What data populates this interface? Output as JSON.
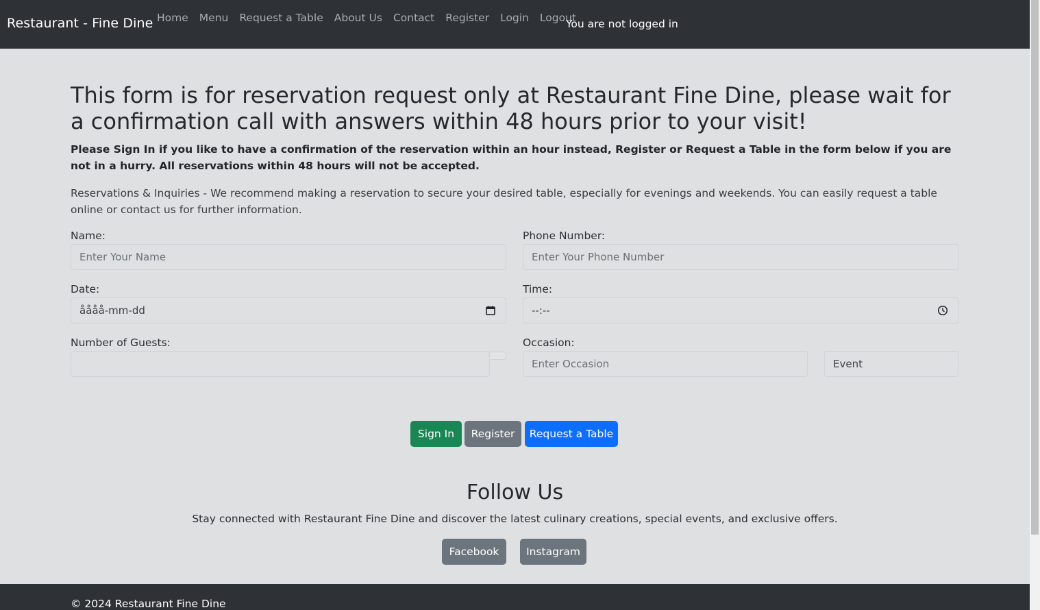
{
  "navbar": {
    "brand": "Restaurant - Fine Dine",
    "links": [
      "Home",
      "Menu",
      "Request a Table",
      "About Us",
      "Contact",
      "Register",
      "Login",
      "Logout"
    ],
    "status": "You are not logged in"
  },
  "main": {
    "title": "This form is for reservation request only at Restaurant Fine Dine, please wait for a confirmation call with answers within 48 hours prior to your visit!",
    "notice": "Please Sign In if you like to have a confirmation of the reservation within an hour instead, Register or Request a Table in the form below if you are not in a hurry. All reservations within 48 hours will not be accepted.",
    "intro": "Reservations & Inquiries - We recommend making a reservation to secure your desired table, especially for evenings and weekends. You can easily request a table online or contact us for further information."
  },
  "form": {
    "name_label": "Name:",
    "name_placeholder": "Enter Your Name",
    "phone_label": "Phone Number:",
    "phone_placeholder": "Enter Your Phone Number",
    "date_label": "Date:",
    "date_value": "åååå-mm-dd",
    "time_label": "Time:",
    "time_value": "--:--",
    "guests_label": "Number of Guests:",
    "occasion_label": "Occasion:",
    "occasion_placeholder": "Enter Occasion",
    "occasion_select_value": "Event"
  },
  "buttons": {
    "sign_in": "Sign In",
    "register": "Register",
    "request_table": "Request a Table"
  },
  "follow": {
    "title": "Follow Us",
    "text": "Stay connected with Restaurant Fine Dine and discover the latest culinary creations, special events, and exclusive offers.",
    "facebook": "Facebook",
    "instagram": "Instagram"
  },
  "footer": {
    "copyright": "© 2024 Restaurant Fine Dine"
  },
  "colors": {
    "navbar_bg": "#2e3236",
    "page_bg": "#dee0e1",
    "success": "#198754",
    "secondary": "#6c757d",
    "primary": "#0d6efd"
  }
}
